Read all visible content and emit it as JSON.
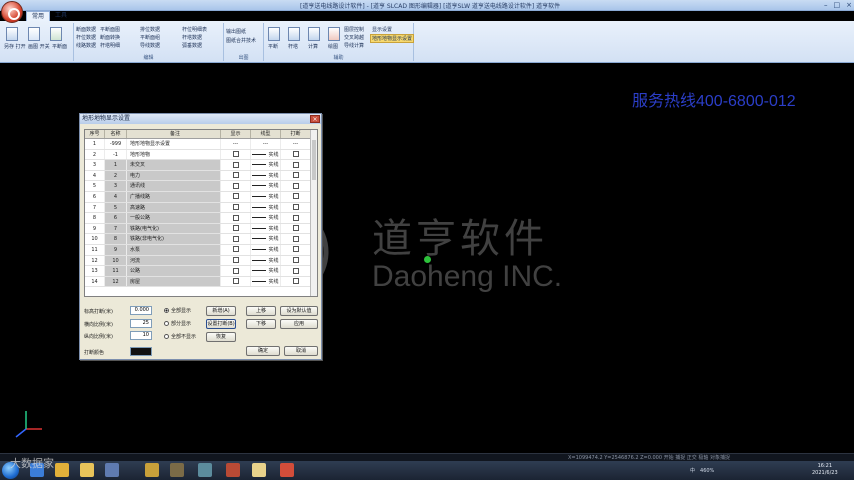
{
  "window": {
    "title": "[道亨送电线路设计软件] - [道亨 SLCAD 图形编辑器] [道亨SLW 道亨送电线路设计软件] 道亨软件",
    "controls": [
      "–",
      "□",
      "×"
    ]
  },
  "tabs": [
    "常用",
    "工具"
  ],
  "ribbon": {
    "groups": [
      {
        "label": "绘图",
        "buttons": [
          "另存 打开",
          "画图 开关",
          "平断面"
        ]
      },
      {
        "label": "编辑",
        "buttons": [
          "断面数据",
          "杆位数据",
          "线路数据",
          "平断面图",
          "断面转换",
          "杆塔明细",
          "排位数据",
          "平断面组",
          "导线数据",
          "杆位明细表",
          "杆塔数据",
          "弧垂数据"
        ]
      },
      {
        "label": "出图",
        "buttons": [
          "输出图纸",
          "图纸合并技术"
        ]
      },
      {
        "label": "辅助",
        "buttons": [
          "平断",
          "杆塔",
          "计算",
          "绘图",
          "图层控制",
          "交叉跨越",
          "导线计算",
          "杆塔数据",
          "图层颜色",
          "显示设置",
          "地形地物显示设置"
        ]
      }
    ],
    "highlighted": "地形地物显示设置"
  },
  "canvas": {
    "hotline": "服务热线400-6800-012",
    "watermark_cn": "道亨软件",
    "watermark_en": "Daoheng INC."
  },
  "dialog": {
    "title": "地形地物显示设置",
    "close": "×",
    "columns": [
      "序号",
      "名称",
      "备注",
      "显示",
      "线型",
      "打断"
    ],
    "rows": [
      {
        "no": "1",
        "code": "-999",
        "name": "地形地物显示设置",
        "show": "---",
        "ltype": "---",
        "brk": "---",
        "selected": false
      },
      {
        "no": "2",
        "code": "-1",
        "name": "地形地物",
        "show": "",
        "ltype": "实线",
        "brk": "",
        "selected": false
      },
      {
        "no": "3",
        "code": "1",
        "name": "未交叉",
        "show": "",
        "ltype": "实线",
        "brk": "",
        "selected": true
      },
      {
        "no": "4",
        "code": "2",
        "name": "电力",
        "show": "",
        "ltype": "实线",
        "brk": "",
        "selected": true
      },
      {
        "no": "5",
        "code": "3",
        "name": "通讯线",
        "show": "",
        "ltype": "实线",
        "brk": "",
        "selected": true
      },
      {
        "no": "6",
        "code": "4",
        "name": "广播线路",
        "show": "",
        "ltype": "实线",
        "brk": "",
        "selected": true
      },
      {
        "no": "7",
        "code": "5",
        "name": "高速路",
        "show": "",
        "ltype": "实线",
        "brk": "",
        "selected": true
      },
      {
        "no": "8",
        "code": "6",
        "name": "一般公路",
        "show": "",
        "ltype": "实线",
        "brk": "",
        "selected": true
      },
      {
        "no": "9",
        "code": "7",
        "name": "铁路(电气化)",
        "show": "",
        "ltype": "实线",
        "brk": "",
        "selected": true
      },
      {
        "no": "10",
        "code": "8",
        "name": "铁路(非电气化)",
        "show": "",
        "ltype": "实线",
        "brk": "",
        "selected": true
      },
      {
        "no": "11",
        "code": "9",
        "name": "水泵",
        "show": "",
        "ltype": "实线",
        "brk": "",
        "selected": true
      },
      {
        "no": "12",
        "code": "10",
        "name": "河流",
        "show": "",
        "ltype": "实线",
        "brk": "",
        "selected": true
      },
      {
        "no": "13",
        "code": "11",
        "name": "公路",
        "show": "",
        "ltype": "实线",
        "brk": "",
        "selected": true
      },
      {
        "no": "14",
        "code": "12",
        "name": "房屋",
        "show": "",
        "ltype": "实线",
        "brk": "",
        "selected": true
      }
    ],
    "form": {
      "label_height": "标高打断(米)",
      "height_value": "0.000",
      "label_ratio": "横向比例(米)",
      "ratio_value": "25",
      "label_scale": "纵向比例(米)",
      "scale_value": "10",
      "label_color": "打断颜色",
      "radio_all": "全部显示",
      "radio_part": "部分显示",
      "radio_none": "全部不显示",
      "btn_add": "新增(A)",
      "btn_insert": "插入(I)",
      "btn_delete": "删除(D)",
      "btn_setbreak": "设置打断(B)",
      "btn_up": "上移",
      "btn_down": "下移",
      "btn_save_default": "设为默认值",
      "btn_apply": "应用",
      "btn_ok": "确定",
      "btn_cancel": "取消",
      "btn_restore": "恢复"
    }
  },
  "status": {
    "coords": "X=1099474.2 Y=2546876.2 Z=0.000 开始 捕捉 正交 极轴 对象捕捉"
  },
  "taskbar": {
    "brand": "大数据家",
    "tray_lang": "中",
    "tray_text": "460%",
    "clock_time": "16:21",
    "clock_date": "2021/6/23"
  },
  "colors": {
    "hotline": "#2b3ec8",
    "highlight": "#f7d96e",
    "dialog_bg": "#ece9d8"
  }
}
